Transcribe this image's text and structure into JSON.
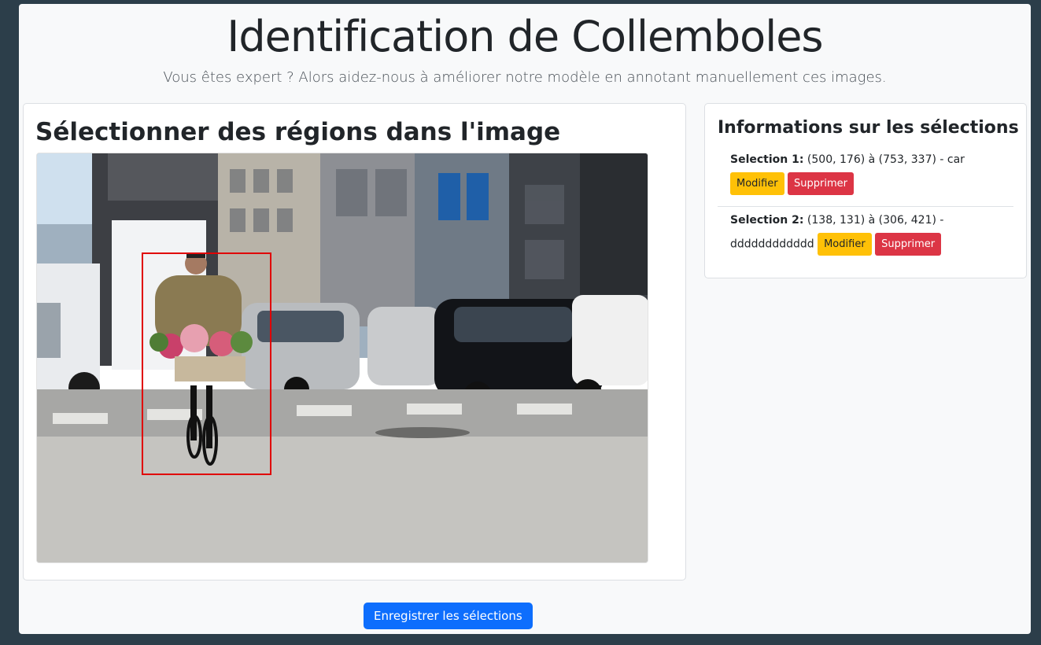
{
  "header": {
    "title": "Identification de Collemboles",
    "subtitle": "Vous êtes expert ? Alors aidez-nous à améliorer notre modèle en annotant manuellement ces images."
  },
  "left_card": {
    "title": "Sélectionner des régions dans l'image"
  },
  "right_card": {
    "title": "Informations sur les sélections",
    "selections": [
      {
        "label": "Selection 1:",
        "text": "(500, 176) à (753, 337) - car",
        "edit": "Modifier",
        "delete": "Supprimer"
      },
      {
        "label": "Selection 2:",
        "text": "(138, 131) à (306, 421) -",
        "tail": "dddddddddddd",
        "edit": "Modifier",
        "delete": "Supprimer"
      }
    ]
  },
  "save_label": "Enregistrer les sélections",
  "colors": {
    "primary": "#0d6efd",
    "warning": "#ffc107",
    "danger": "#dc3545",
    "selection_box": "#e00000"
  }
}
